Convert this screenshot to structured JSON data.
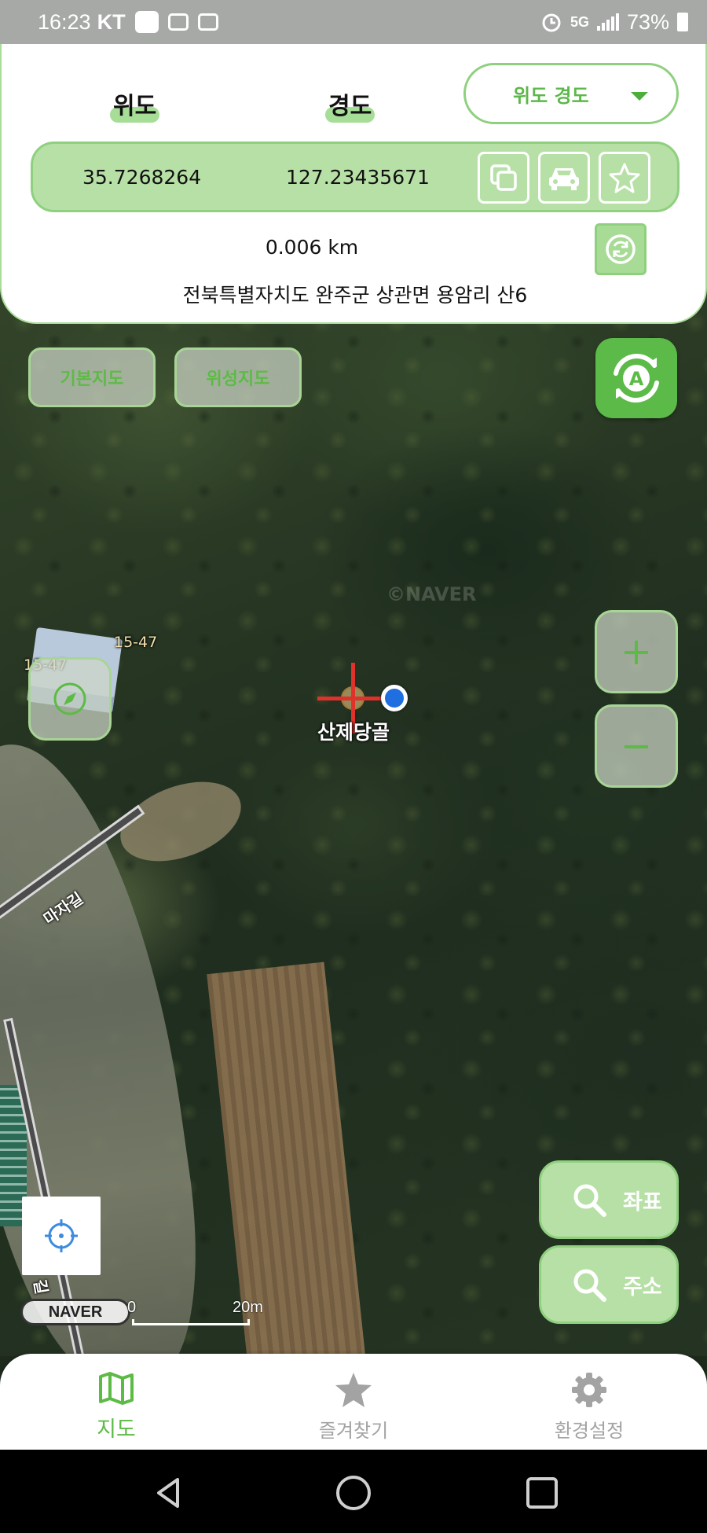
{
  "status_bar": {
    "time": "16:23",
    "carrier": "KT",
    "network": "5G",
    "battery": "73%"
  },
  "coords_panel": {
    "lat_label": "위도",
    "lon_label": "경도",
    "format_selected": "위도 경도",
    "lat_value": "35.7268264",
    "lon_value": "127.23435671",
    "distance": "0.006 km",
    "address": "전북특별자치도 완주군 상관면 용암리 산6"
  },
  "map_controls": {
    "basic_map_label": "기본지도",
    "satellite_map_label": "위성지도",
    "zoom_in_label": "+",
    "zoom_out_label": "−",
    "search_coord_label": "좌표",
    "search_address_label": "주소"
  },
  "map_labels": {
    "place_name": "산제당골",
    "parcel_1": "15-47",
    "parcel_2": "15-47",
    "road_name": "마자길",
    "road_name_2": "길",
    "watermark": "©NAVER",
    "naver_logo": "NAVER",
    "scale_zero": "0",
    "scale_max": "20m"
  },
  "bottom_nav": {
    "items": [
      {
        "label": "지도",
        "icon": "map-icon",
        "active": true
      },
      {
        "label": "즐겨찾기",
        "icon": "star-icon",
        "active": false
      },
      {
        "label": "환경설정",
        "icon": "gear-icon",
        "active": false
      }
    ]
  },
  "colors": {
    "accent": "#5cbb45",
    "accent_light": "#b7e0a6",
    "crosshair": "#e0312a",
    "location_dot": "#1f6fe0"
  }
}
